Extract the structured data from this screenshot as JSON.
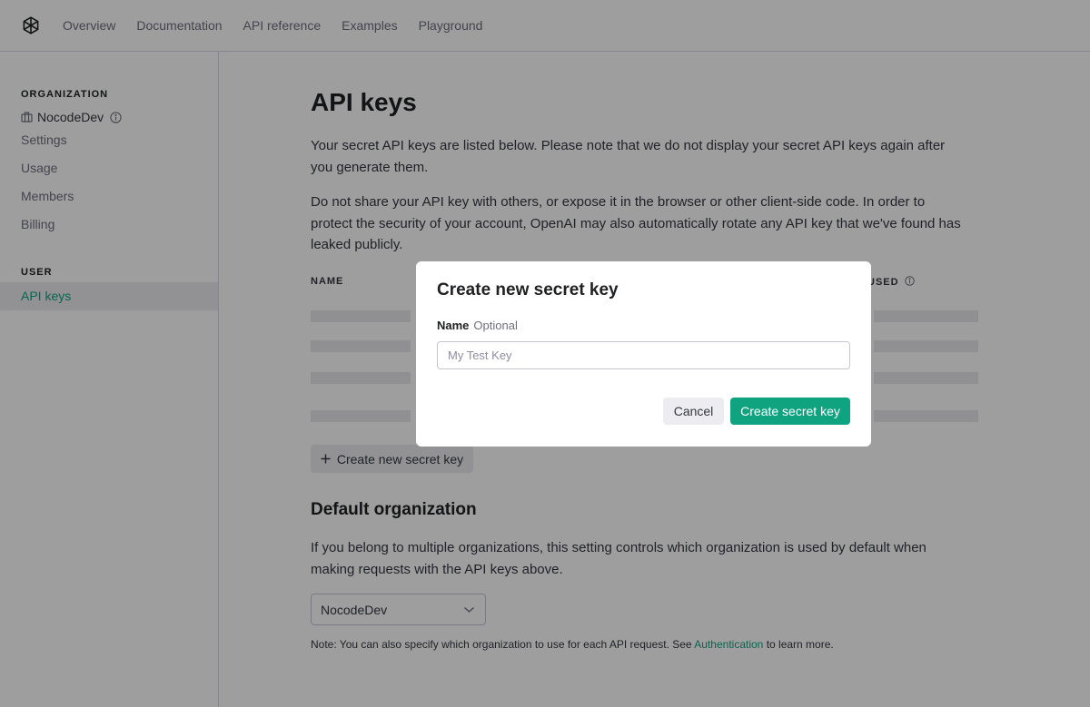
{
  "nav": {
    "links": [
      "Overview",
      "Documentation",
      "API reference",
      "Examples",
      "Playground"
    ]
  },
  "sidebar": {
    "org_heading": "ORGANIZATION",
    "org_name": "NocodeDev",
    "org_items": [
      "Settings",
      "Usage",
      "Members",
      "Billing"
    ],
    "user_heading": "USER",
    "user_items": [
      "API keys"
    ]
  },
  "main": {
    "title": "API keys",
    "intro": "Your secret API keys are listed below. Please note that we do not display your secret API keys again after you generate them.",
    "warning": "Do not share your API key with others, or expose it in the browser or other client-side code. In order to protect the security of your account, OpenAI may also automatically rotate any API key that we've found has leaked publicly.",
    "table": {
      "col_name": "NAME",
      "col_last_used": "USED"
    },
    "create_button": "Create new secret key",
    "default_org": {
      "title": "Default organization",
      "description": "If you belong to multiple organizations, this setting controls which organization is used by default when making requests with the API keys above.",
      "selected": "NocodeDev",
      "note_prefix": "Note: You can also specify which organization to use for each API request. See",
      "note_link": "Authentication",
      "note_suffix": "to learn more."
    }
  },
  "modal": {
    "title": "Create new secret key",
    "field_label": "Name",
    "field_optional": "Optional",
    "placeholder": "My Test Key",
    "cancel": "Cancel",
    "submit": "Create secret key"
  },
  "colors": {
    "accent": "#10a37f",
    "overlay": "rgba(0,0,0,0.38)"
  },
  "icons": [
    "openai-logo-icon",
    "building-icon",
    "info-icon",
    "plus-icon",
    "chevron-down-icon"
  ]
}
